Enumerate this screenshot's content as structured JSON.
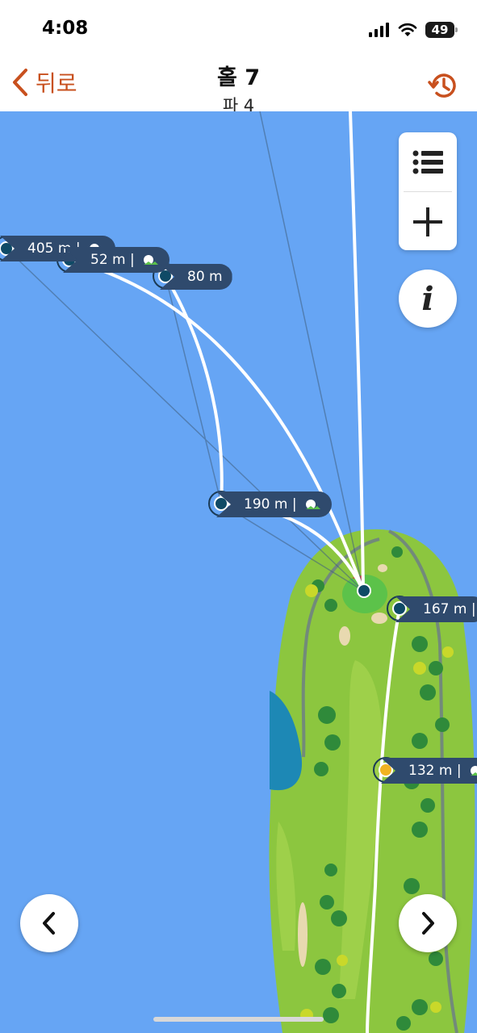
{
  "status": {
    "time": "4:08",
    "battery": "49"
  },
  "nav": {
    "back_label": "뒤로",
    "title": "홀 7",
    "subtitle": "파 4"
  },
  "map": {
    "labels": {
      "shot1": "405 m |",
      "shot2": "52 m |",
      "shot3": "80 m",
      "shot4": "190 m |",
      "shot5": "167 m |",
      "shot6": "132 m |"
    }
  },
  "colors": {
    "accent": "#c8501e",
    "water": "#66a5f4",
    "fairway": "#8cc63f",
    "green": "#5cc24a",
    "label_bg": "#2f4a6d",
    "marker": "#0f4a66",
    "marker_current": "#f2b321"
  },
  "icons": {
    "back": "chevron-left-icon",
    "history": "history-icon",
    "list": "list-icon",
    "zoom_in": "plus-icon",
    "info": "info-icon",
    "prev": "chevron-left-icon",
    "next": "chevron-right-icon"
  }
}
